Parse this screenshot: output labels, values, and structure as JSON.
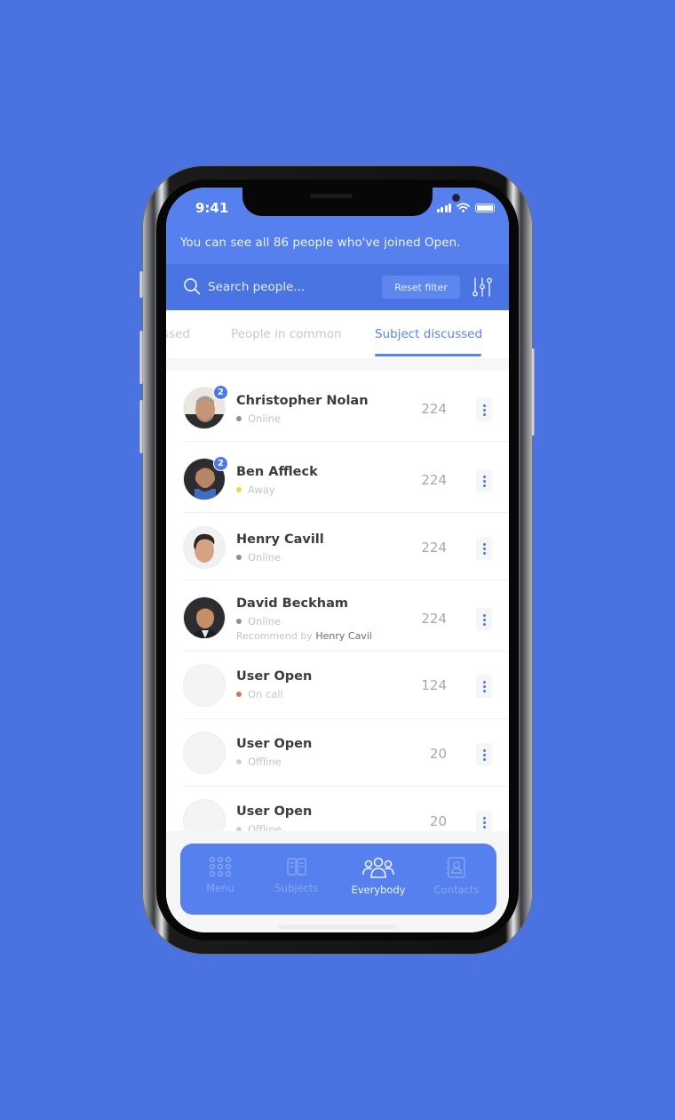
{
  "status_bar": {
    "time": "9:41"
  },
  "banner": {
    "text": "You can see all 86 people who've joined Open."
  },
  "search": {
    "placeholder": "Search people...",
    "value": "",
    "reset_label": "Reset filter"
  },
  "tabs": [
    {
      "label": "ssed",
      "active": false
    },
    {
      "label": "People in common",
      "active": false
    },
    {
      "label": "Subject discussed",
      "active": true
    }
  ],
  "people": [
    {
      "name": "Christopher Nolan",
      "status": "Online",
      "status_color": "#8e9094",
      "count": "224",
      "badge": "2",
      "has_photo": true
    },
    {
      "name": "Ben Affleck",
      "status": "Away",
      "status_color": "#f5d63a",
      "count": "224",
      "badge": "2",
      "has_photo": true
    },
    {
      "name": "Henry Cavill",
      "status": "Online",
      "status_color": "#8e9094",
      "count": "224",
      "badge": null,
      "has_photo": true
    },
    {
      "name": "David Beckham",
      "status": "Online",
      "status_color": "#8e9094",
      "count": "224",
      "badge": null,
      "has_photo": true,
      "recommend_prefix": "Recommend by",
      "recommend_name": "Henry Cavil"
    },
    {
      "name": "User Open",
      "status": "On call",
      "status_color": "#c77a55",
      "count": "124",
      "badge": null,
      "has_photo": false
    },
    {
      "name": "User Open",
      "status": "Offline",
      "status_color": "#cfd0d3",
      "count": "20",
      "badge": null,
      "has_photo": false
    },
    {
      "name": "User Open",
      "status": "Offline",
      "status_color": "#cfd0d3",
      "count": "20",
      "badge": null,
      "has_photo": false
    }
  ],
  "tabbar": [
    {
      "label": "Menu",
      "icon": "menu-grid-icon",
      "active": false
    },
    {
      "label": "Subjects",
      "icon": "book-icon",
      "active": false
    },
    {
      "label": "Everybody",
      "icon": "group-icon",
      "active": true
    },
    {
      "label": "Contacts",
      "icon": "contacts-book-icon",
      "active": false
    }
  ],
  "colors": {
    "background": "#4a72e0",
    "primary": "#5580ee",
    "accent": "#5a83ee"
  }
}
